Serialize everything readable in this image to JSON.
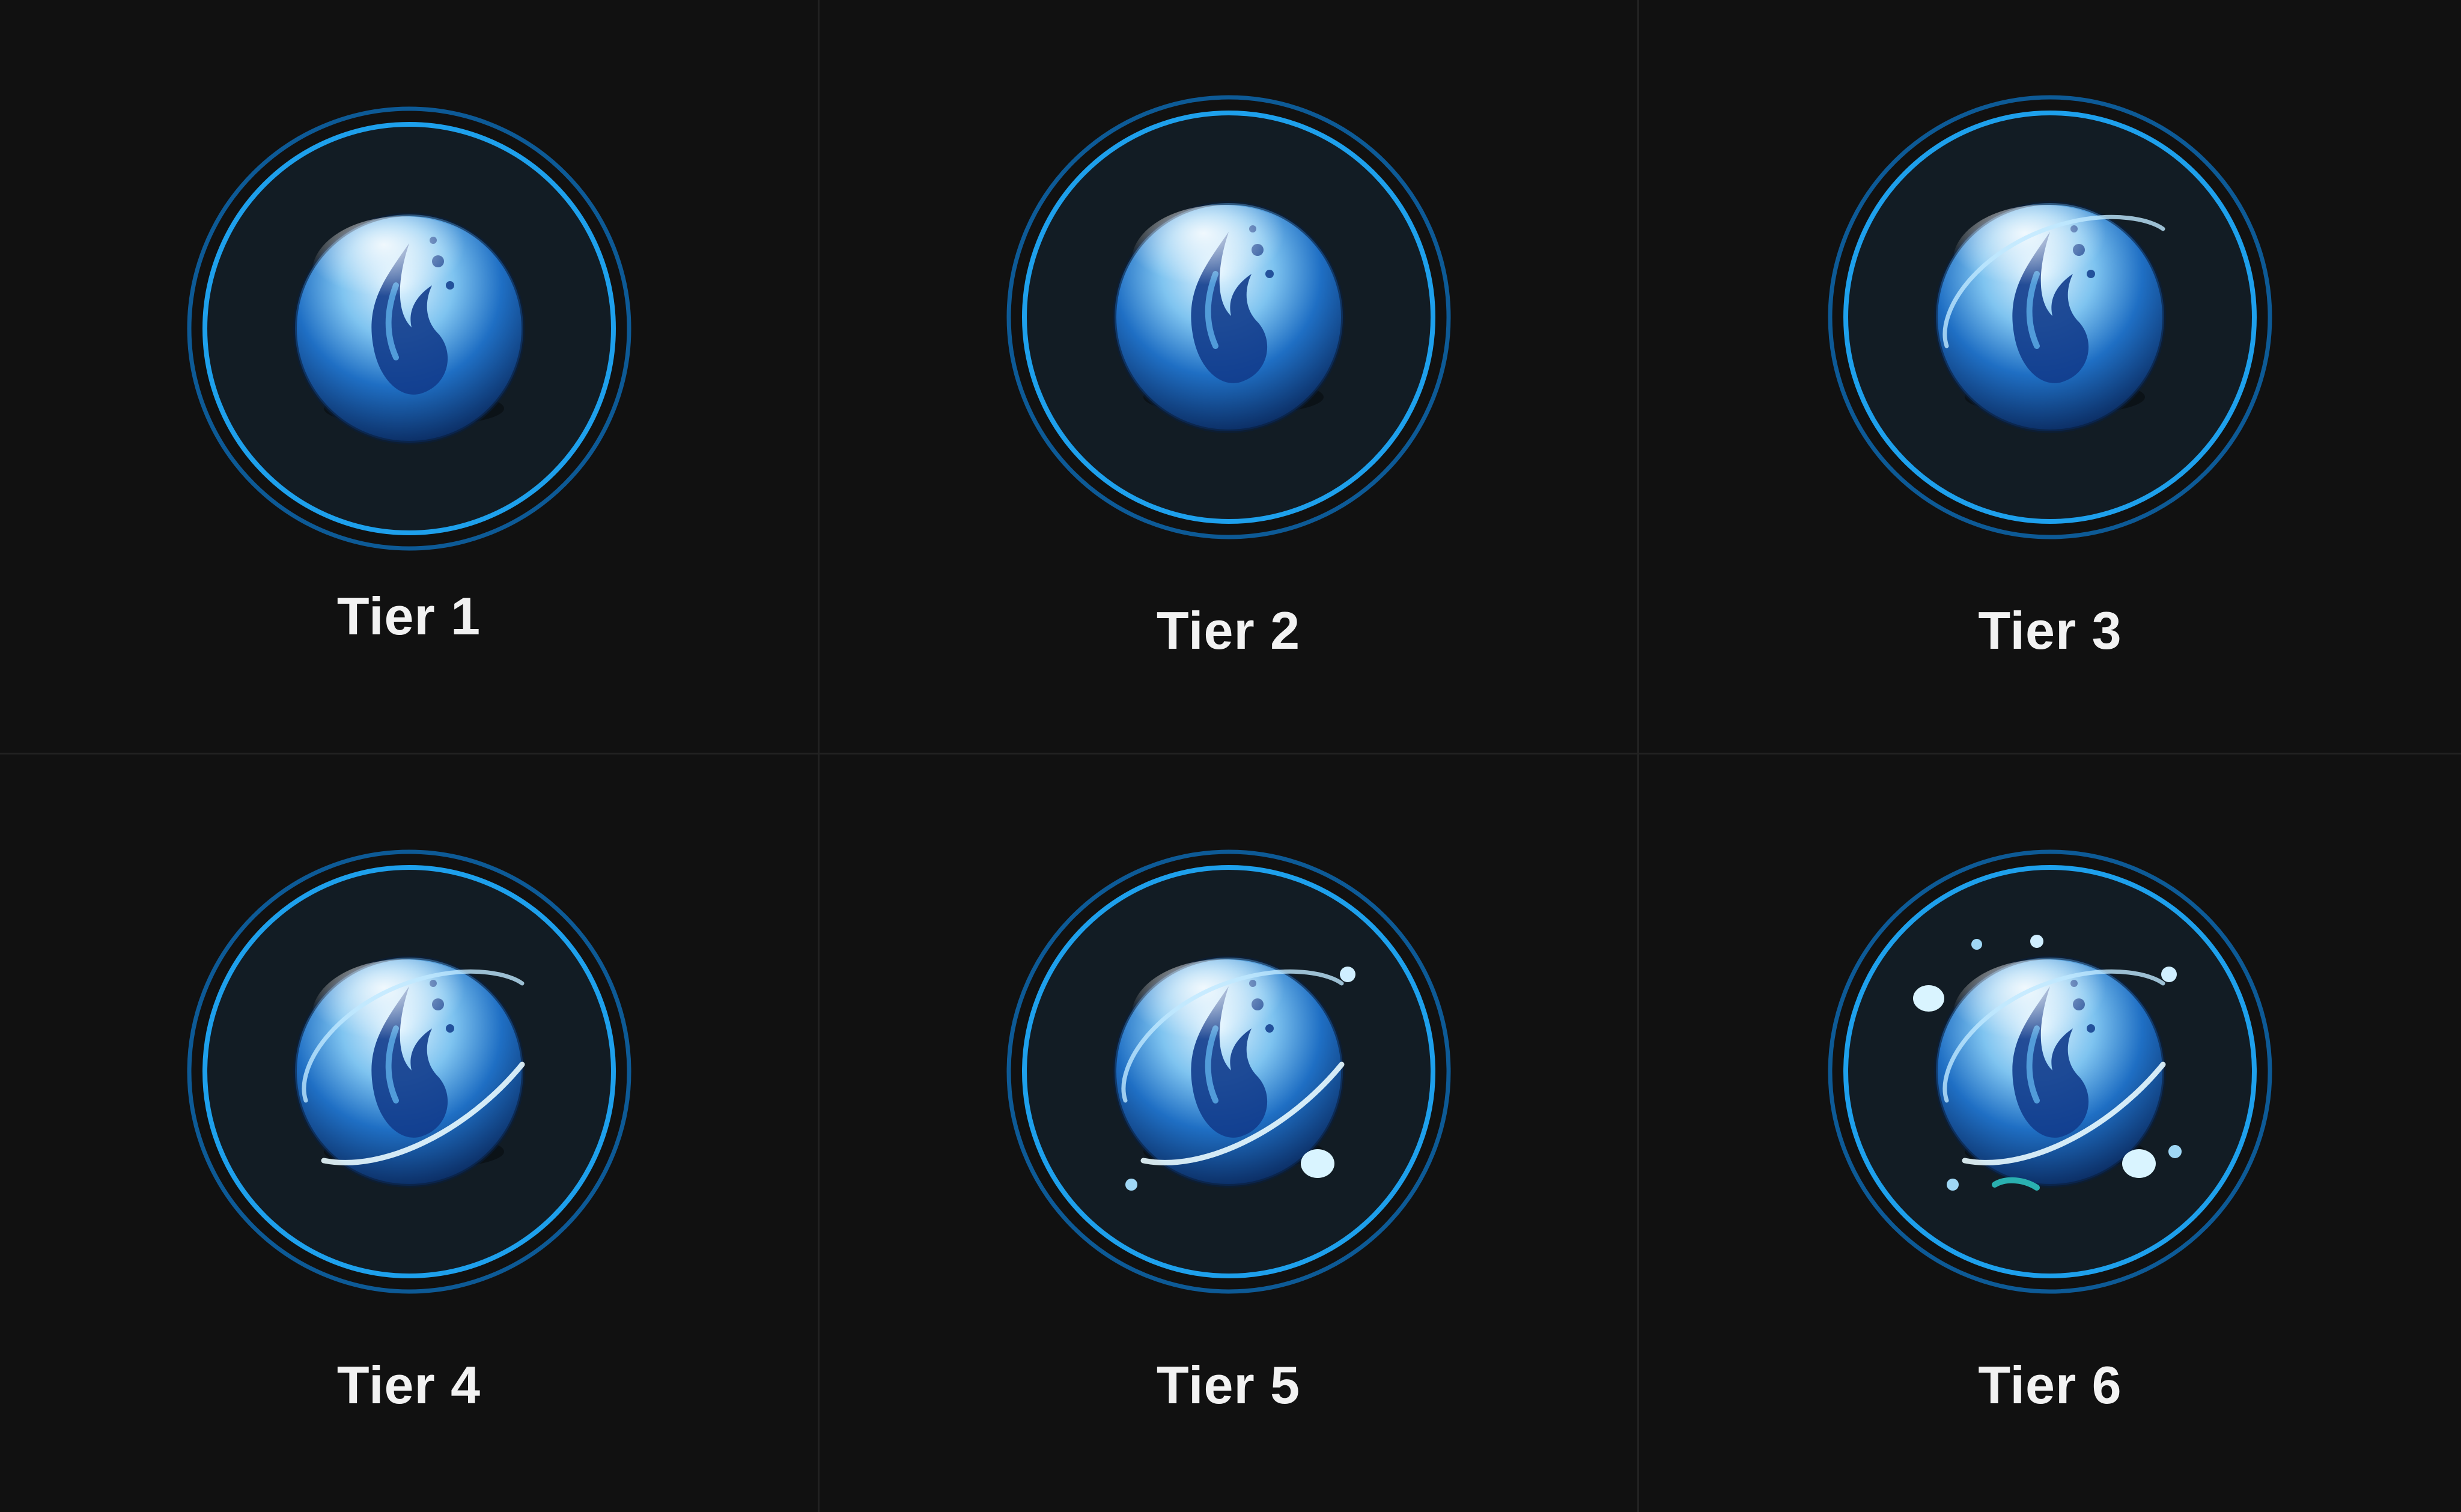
{
  "colors": {
    "background": "#111111",
    "divider": "#222222",
    "ring_outer": "#0d5a96",
    "ring_inner": "#1ea0ec",
    "disc_fill": "#121c24",
    "label": "#f2f2f2"
  },
  "tiers": [
    {
      "label": "Tier 1",
      "icon": "water-orb-icon",
      "level": 1
    },
    {
      "label": "Tier 2",
      "icon": "water-orb-icon",
      "level": 2
    },
    {
      "label": "Tier 3",
      "icon": "water-orb-icon",
      "level": 3
    },
    {
      "label": "Tier 4",
      "icon": "water-orb-icon",
      "level": 4
    },
    {
      "label": "Tier 5",
      "icon": "water-orb-icon",
      "level": 5
    },
    {
      "label": "Tier 6",
      "icon": "water-orb-icon",
      "level": 6
    }
  ]
}
